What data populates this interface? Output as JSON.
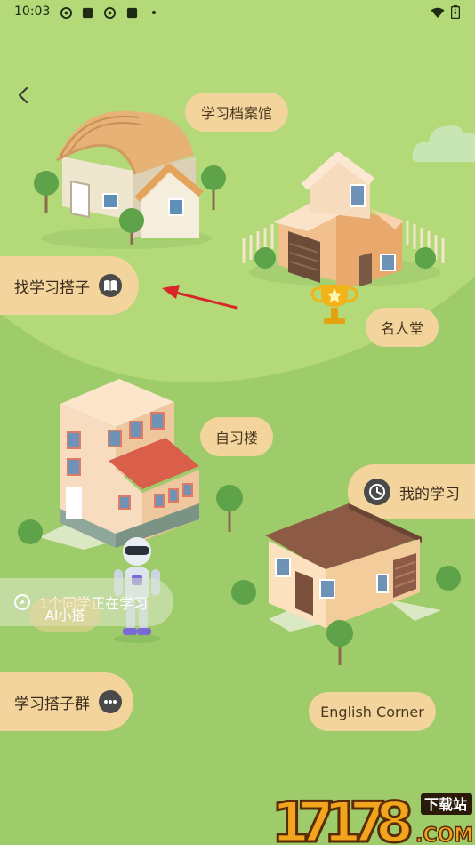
{
  "status_bar": {
    "time": "10:03"
  },
  "buildings": {
    "archive_label": "学习档案馆",
    "hall_label": "名人堂",
    "study_hall_label": "自习楼",
    "english_label": "English Corner"
  },
  "side_buttons": {
    "find_partner": "找学习搭子",
    "partner_group": "学习搭子群",
    "my_study": "我的学习"
  },
  "banner": {
    "studying_text": "1个同学正在学习",
    "ai_label": "AI小搭"
  },
  "watermark": {
    "number": "17178",
    "suffix": ".COM",
    "label": "下载站"
  },
  "colors": {
    "grass": "#9fcc6a",
    "grass_light": "#b4d978",
    "pill": "#f3d49c",
    "arrow": "#d8262a"
  }
}
